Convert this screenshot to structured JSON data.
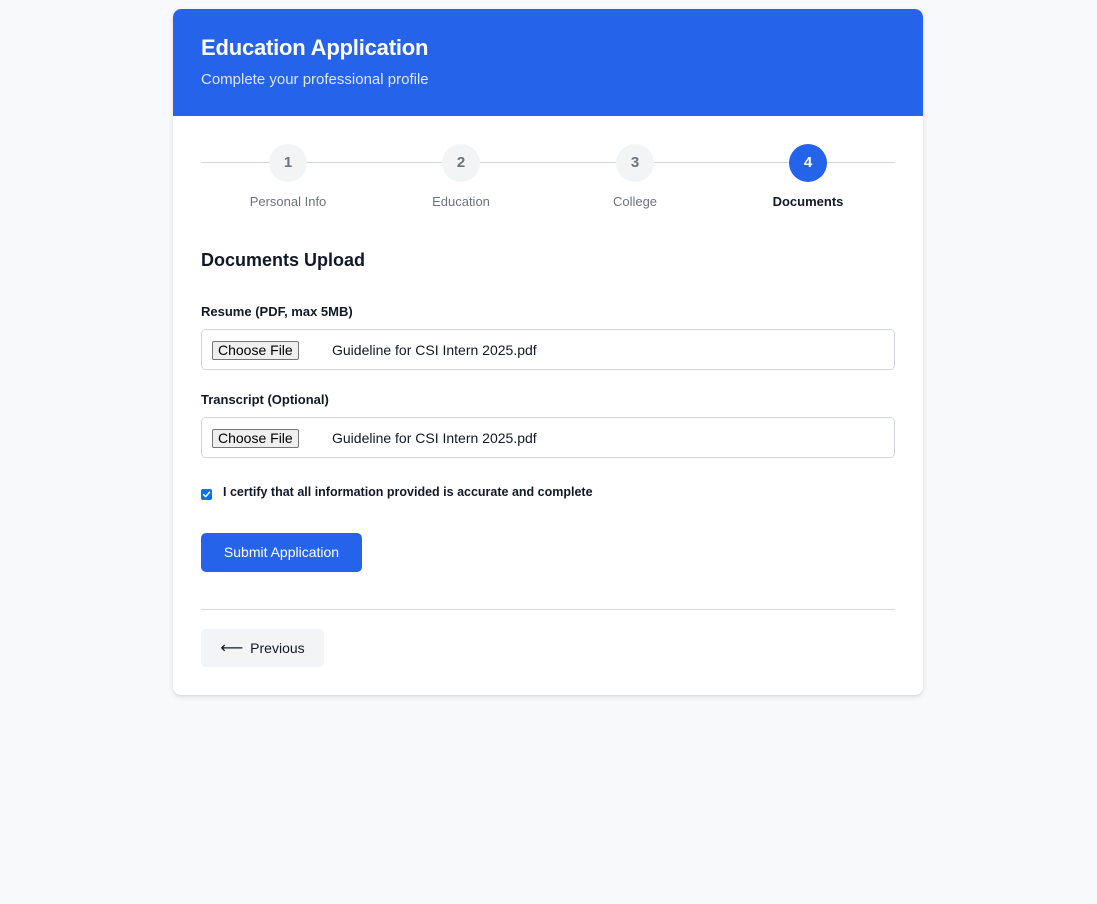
{
  "header": {
    "title": "Education Application",
    "subtitle": "Complete your professional profile"
  },
  "stepper": {
    "steps": [
      {
        "number": "1",
        "label": "Personal Info",
        "active": false
      },
      {
        "number": "2",
        "label": "Education",
        "active": false
      },
      {
        "number": "3",
        "label": "College",
        "active": false
      },
      {
        "number": "4",
        "label": "Documents",
        "active": true
      }
    ]
  },
  "section": {
    "title": "Documents Upload"
  },
  "resume": {
    "label": "Resume (PDF, max 5MB)",
    "button_label": "Choose File",
    "file_name": "Guideline for CSI Intern 2025.pdf"
  },
  "transcript": {
    "label": "Transcript (Optional)",
    "button_label": "Choose File",
    "file_name": "Guideline for CSI Intern 2025.pdf"
  },
  "certify": {
    "checked": true,
    "label": "I certify that all information provided is accurate and complete"
  },
  "actions": {
    "submit_label": "Submit Application",
    "previous_arrow": "⟵",
    "previous_label": "Previous"
  },
  "colors": {
    "accent": "#2563eb",
    "background": "#f8f9fb",
    "muted_text": "#6b7280"
  }
}
